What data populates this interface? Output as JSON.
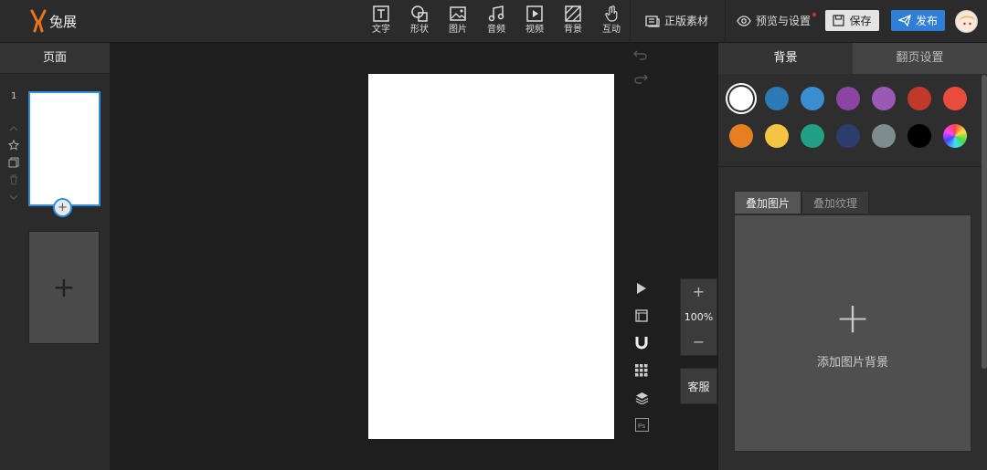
{
  "app": {
    "logo_text": "兔展"
  },
  "toolbar": {
    "tools": [
      {
        "label": "文字",
        "icon": "text-icon"
      },
      {
        "label": "形状",
        "icon": "shape-icon"
      },
      {
        "label": "图片",
        "icon": "image-icon"
      },
      {
        "label": "音频",
        "icon": "music-icon"
      },
      {
        "label": "视频",
        "icon": "video-icon"
      },
      {
        "label": "背景",
        "icon": "background-icon"
      },
      {
        "label": "互动",
        "icon": "hand-icon"
      }
    ],
    "material_label": "正版素材",
    "preview_label": "预览与设置",
    "save_label": "保存",
    "publish_label": "发布"
  },
  "left_panel": {
    "title": "页面",
    "page_number": "1"
  },
  "zoom": {
    "value": "100%",
    "plus": "+",
    "minus": "−"
  },
  "kefu_label": "客服",
  "right_panel": {
    "tabs": [
      "背景",
      "翻页设置"
    ],
    "swatches": [
      "#ffffff",
      "#2b79b5",
      "#3a8ed0",
      "#8b44a2",
      "#9b59b6",
      "#c0392b",
      "#e74c3c",
      "#e67e22",
      "#f4c542",
      "#22a085",
      "#2c3e6e",
      "#7f8c8d",
      "#000000",
      "rainbow"
    ],
    "subtabs": [
      "叠加图片",
      "叠加纹理"
    ],
    "add_bg_label": "添加图片背景"
  }
}
